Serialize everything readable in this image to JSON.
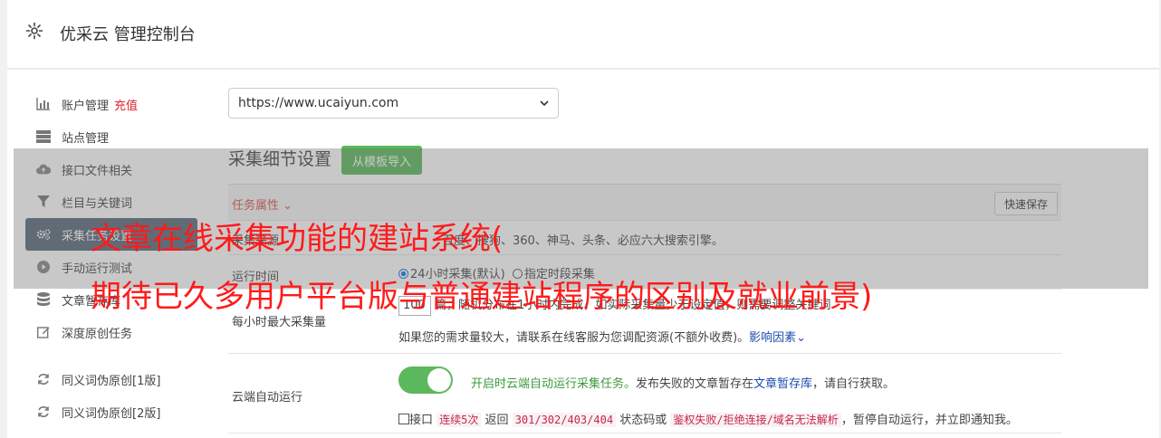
{
  "header": {
    "title": "优采云 管理控制台",
    "icon": "gear-icon"
  },
  "sidebar": {
    "items": [
      {
        "label": "账户管理",
        "extra": "充值",
        "icon": "bar-chart-icon"
      },
      {
        "label": "站点管理",
        "icon": "server-icon"
      },
      {
        "label": "接口文件相关",
        "icon": "cloud-upload-icon"
      },
      {
        "label": "栏目与关键词",
        "icon": "filter-icon"
      },
      {
        "label": "采集任务设置",
        "icon": "gears-icon",
        "active": true
      },
      {
        "label": "手动运行测试",
        "icon": "play-circle-icon"
      },
      {
        "label": "文章暂存库",
        "icon": "database-icon"
      },
      {
        "label": "深度原创任务",
        "icon": "edit-icon"
      },
      {
        "label": "同义词伪原创[1版]",
        "icon": "refresh-icon"
      },
      {
        "label": "同义词伪原创[2版]",
        "icon": "refresh-icon"
      }
    ]
  },
  "main": {
    "site_select": "https://www.ucaiyun.com",
    "section_title": "采集细节设置",
    "import_button": "从模板导入",
    "task_attr": "任务属性",
    "quick_save": "快速保存",
    "row_engines": {
      "label": "采集来源",
      "value": "百度、搜狗、360、神马、头条、必应六大搜索引擎。"
    },
    "row_runtime": {
      "label": "运行时间",
      "opt1": "24小时采集(默认)",
      "opt2": "指定时段采集"
    },
    "row_max": {
      "label": "每小时最大采集量",
      "input_value": "100",
      "line1": "篇，随机分布在1小时内完成，如实际采集量少于设定值，则需要调整关键词",
      "line2": "如果您的需求量较大，请联系在线客服为您调配资源(不额外收费)。",
      "link": "影响因素"
    },
    "row_cloud": {
      "label": "云端自动运行",
      "status_text": "开启时云端自动运行采集任务。",
      "desc1": "发布失败的文章暂存在",
      "link": "文章暂存库",
      "desc2": "，请自行获取。",
      "cb_prefix": "接口",
      "code1": "连续5次",
      "mid1": "返回",
      "code2": "301/302/403/404",
      "mid2": "状态码或",
      "code3": "鉴权失败/拒绝连接/域名无法解析",
      "tail": "，暂停自动运行，并立即通知我。"
    }
  },
  "overlay": {
    "line1": "文章在线采集功能的建站系统(",
    "line2": "期待已久多用户平台版与普通建站程序的区别及就业前景)"
  },
  "colors": {
    "accent_green": "#5cb85c",
    "overlay_red": "#ff1a1a",
    "active_nav": "#5a6a7a"
  }
}
